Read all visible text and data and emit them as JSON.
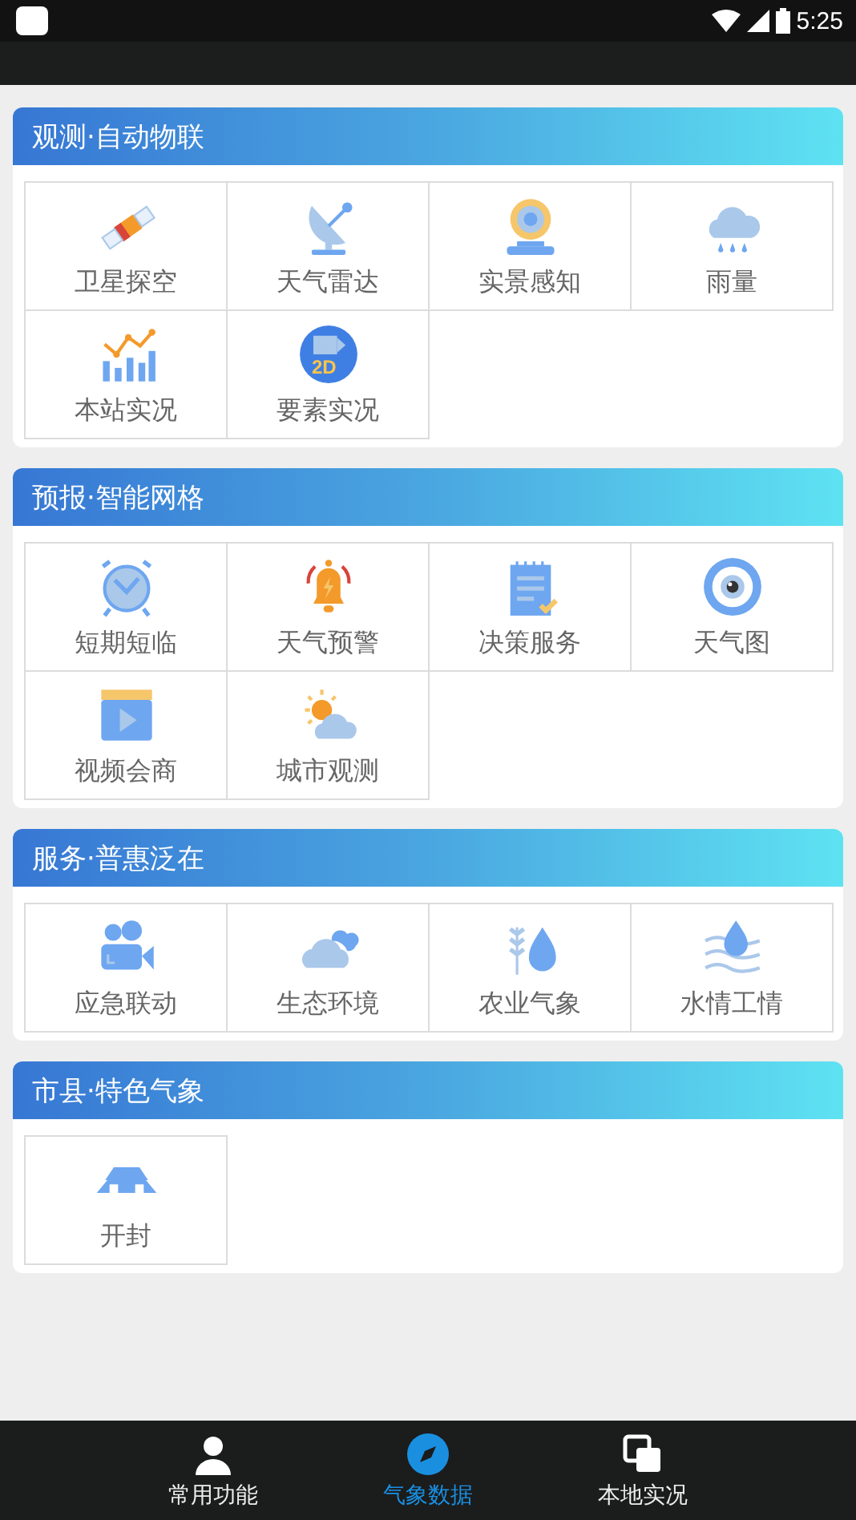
{
  "status_bar": {
    "time": "5:25"
  },
  "sections": [
    {
      "title": "观测·自动物联",
      "items": [
        {
          "label": "卫星探空"
        },
        {
          "label": "天气雷达"
        },
        {
          "label": "实景感知"
        },
        {
          "label": "雨量"
        },
        {
          "label": "本站实况"
        },
        {
          "label": "要素实况",
          "icon_text": "2D"
        }
      ]
    },
    {
      "title": "预报·智能网格",
      "items": [
        {
          "label": "短期短临"
        },
        {
          "label": "天气预警"
        },
        {
          "label": "决策服务"
        },
        {
          "label": "天气图"
        },
        {
          "label": "视频会商"
        },
        {
          "label": "城市观测"
        }
      ]
    },
    {
      "title": "服务·普惠泛在",
      "items": [
        {
          "label": "应急联动"
        },
        {
          "label": "生态环境"
        },
        {
          "label": "农业气象"
        },
        {
          "label": "水情工情"
        }
      ]
    },
    {
      "title": "市县·特色气象",
      "items": [
        {
          "label": "开封"
        }
      ]
    }
  ],
  "bottom_nav": [
    {
      "label": "常用功能",
      "selected": false
    },
    {
      "label": "气象数据",
      "selected": true
    },
    {
      "label": "本地实况",
      "selected": false
    }
  ]
}
